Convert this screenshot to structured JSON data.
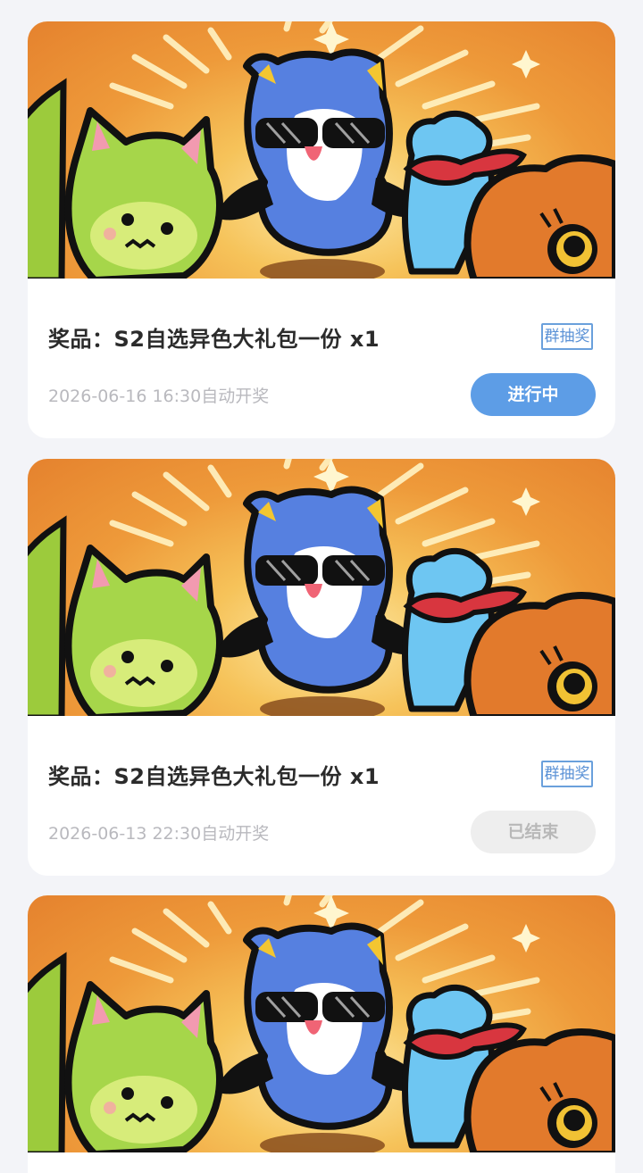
{
  "lotteries": [
    {
      "banner_image": "pokemon-trio-artwork",
      "prize": "奖品：S2自选异色大礼包一份 x1",
      "tag": "群抽奖",
      "draw_time": "2026-06-16 16:30自动开奖",
      "status": "进行中",
      "status_state": "active"
    },
    {
      "banner_image": "pokemon-trio-artwork",
      "prize": "奖品：S2自选异色大礼包一份 x1",
      "tag": "群抽奖",
      "draw_time": "2026-06-13 22:30自动开奖",
      "status": "已结束",
      "status_state": "ended"
    },
    {
      "banner_image": "pokemon-trio-artwork"
    }
  ],
  "colors": {
    "page_background": "#f3f4f8",
    "active_button": "#5d9de6",
    "ended_button": "#eeeeee",
    "tag_blue": "#5b92d6",
    "banner_orange": "#e5822e"
  }
}
